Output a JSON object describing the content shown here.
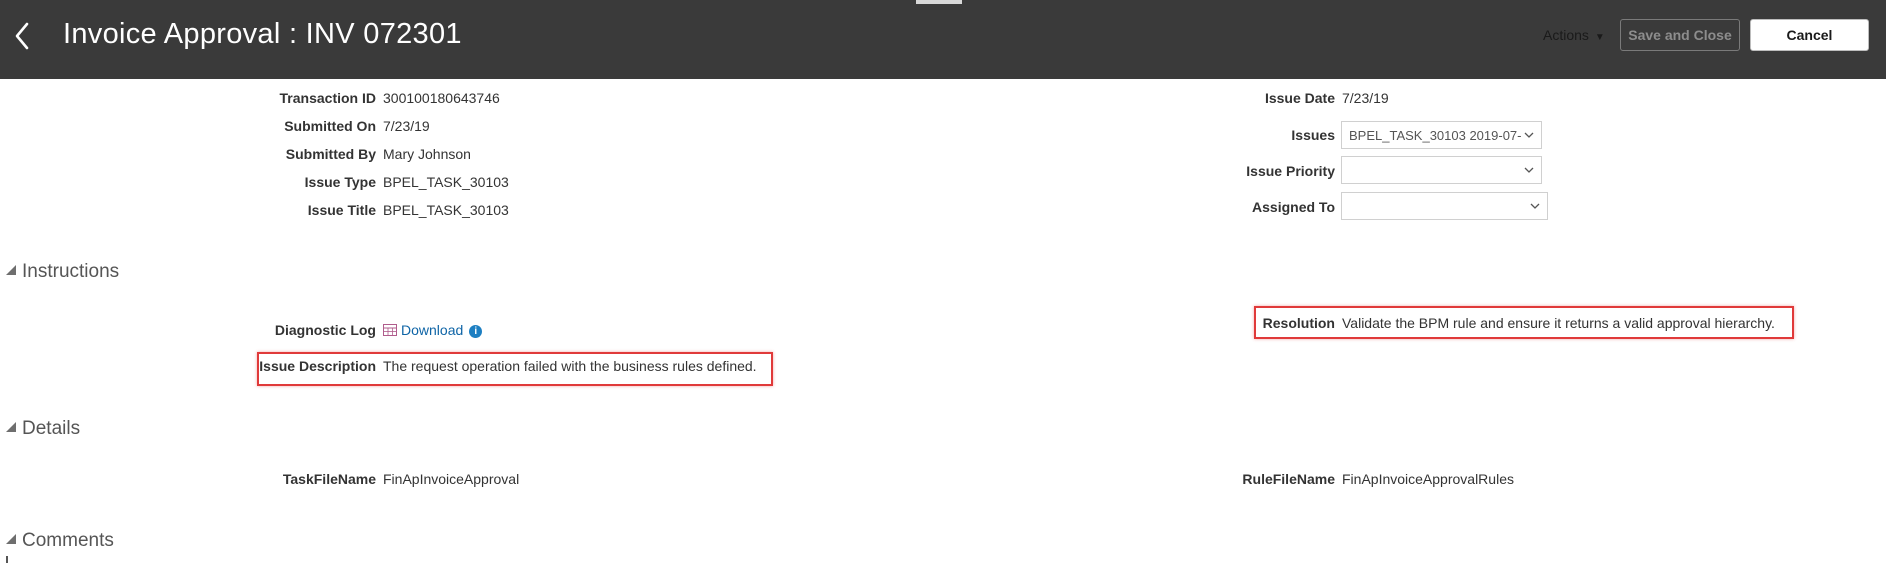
{
  "header": {
    "title": "Invoice Approval : INV 072301",
    "actions_label": "Actions",
    "save_close_label": "Save and Close",
    "cancel_label": "Cancel"
  },
  "summary": {
    "left": [
      {
        "label": "Transaction ID",
        "value": "300100180643746"
      },
      {
        "label": "Submitted On",
        "value": "7/23/19"
      },
      {
        "label": "Submitted By",
        "value": "Mary Johnson"
      },
      {
        "label": "Issue Type",
        "value": "BPEL_TASK_30103"
      },
      {
        "label": "Issue Title",
        "value": "BPEL_TASK_30103"
      }
    ],
    "right": {
      "issue_date_label": "Issue Date",
      "issue_date_value": "7/23/19",
      "issues_label": "Issues",
      "issues_value": "BPEL_TASK_30103 2019-07-",
      "priority_label": "Issue Priority",
      "priority_value": "",
      "assigned_label": "Assigned To",
      "assigned_value": ""
    }
  },
  "instructions": {
    "section_label": "Instructions",
    "diagnostic_label": "Diagnostic Log",
    "download_label": "Download",
    "info_glyph": "i",
    "description_label": "Issue Description",
    "description_value": "The request operation failed with the business rules defined.",
    "resolution_label": "Resolution",
    "resolution_value": "Validate the BPM rule and ensure it returns a valid approval hierarchy."
  },
  "details": {
    "section_label": "Details",
    "taskfile_label": "TaskFileName",
    "taskfile_value": "FinApInvoiceApproval",
    "rulefile_label": "RuleFileName",
    "rulefile_value": "FinApInvoiceApprovalRules"
  },
  "comments": {
    "section_label": "Comments"
  },
  "icons": {
    "back": "chevron-left-icon",
    "actions_caret": "caret-down-icon",
    "dropdown": "chevron-down-icon",
    "section": "collapse-triangle-icon",
    "download": "spreadsheet-download-icon",
    "info": "info-icon"
  },
  "colors": {
    "header_bg": "#3a3a3a",
    "highlight": "#e03a3a",
    "link": "#0e64a6",
    "info": "#1d7fc2"
  }
}
